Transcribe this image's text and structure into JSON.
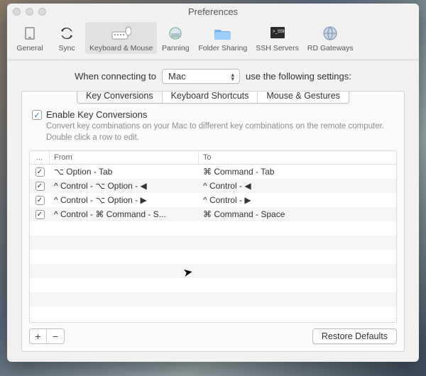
{
  "window": {
    "title": "Preferences"
  },
  "toolbar": {
    "items": [
      {
        "label": "General",
        "icon": "general"
      },
      {
        "label": "Sync",
        "icon": "sync"
      },
      {
        "label": "Keyboard & Mouse",
        "icon": "keyboard",
        "selected": true
      },
      {
        "label": "Panning",
        "icon": "panning"
      },
      {
        "label": "Folder Sharing",
        "icon": "folder"
      },
      {
        "label": "SSH Servers",
        "icon": "ssh"
      },
      {
        "label": "RD Gateways",
        "icon": "gateway"
      }
    ]
  },
  "connect": {
    "prefix": "When connecting to",
    "selected": "Mac",
    "suffix": "use the following settings:"
  },
  "tabs": {
    "items": [
      "Key Conversions",
      "Keyboard Shortcuts",
      "Mouse & Gestures"
    ],
    "active": 0
  },
  "enable": {
    "checked": true,
    "label": "Enable Key Conversions",
    "desc": "Convert key combinations on your Mac to different key combinations on the remote computer. Double click a row to edit."
  },
  "table": {
    "headers": {
      "c0": "...",
      "c1": "From",
      "c2": "To"
    },
    "rows": [
      {
        "on": true,
        "from": "⌥ Option - Tab",
        "to": "⌘ Command - Tab"
      },
      {
        "on": true,
        "from": "^ Control - ⌥ Option - ◀",
        "to": "^ Control - ◀"
      },
      {
        "on": true,
        "from": "^ Control - ⌥ Option - ▶",
        "to": "^ Control - ▶"
      },
      {
        "on": true,
        "from": "^ Control - ⌘ Command - S...",
        "to": "⌘ Command - Space"
      }
    ]
  },
  "buttons": {
    "add": "+",
    "remove": "−",
    "restore": "Restore Defaults"
  }
}
